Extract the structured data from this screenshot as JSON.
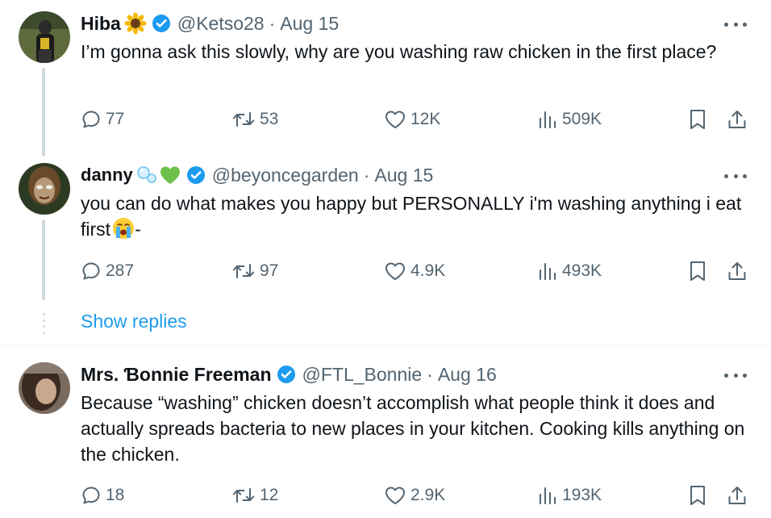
{
  "tweets": [
    {
      "name": "Hiba",
      "name_emoji": "sunflower",
      "handle": "@Ketso28",
      "date": "Aug 15",
      "text": "I’m gonna ask this slowly, why are you washing raw chicken in the first place?",
      "replies": "77",
      "retweets": "53",
      "likes": "12K",
      "views": "509K"
    },
    {
      "name": "danny",
      "name_emoji": "bubbles green-heart",
      "handle": "@beyoncegarden",
      "date": "Aug 15",
      "text": "you can do what makes you happy but PERSONALLY i'm washing anything i eat first",
      "text_suffix": "-",
      "text_emoji": "loudly-crying-face",
      "replies": "287",
      "retweets": "97",
      "likes": "4.9K",
      "views": "493K"
    },
    {
      "name": "Mrs. Ɓonnie Freeman",
      "handle": "@FTL_Bonnie",
      "date": "Aug 16",
      "text": "Because “washing” chicken doesn’t accomplish what people think it does and actually spreads bacteria to new places in your kitchen. Cooking kills anything on the chicken.",
      "replies": "18",
      "retweets": "12",
      "likes": "2.9K",
      "views": "193K"
    }
  ],
  "show_replies_label": "Show replies",
  "date_separator": "·",
  "colors": {
    "accent": "#1d9bf0",
    "text": "#0f1419",
    "secondary": "#536471",
    "line": "#cfd9de"
  }
}
